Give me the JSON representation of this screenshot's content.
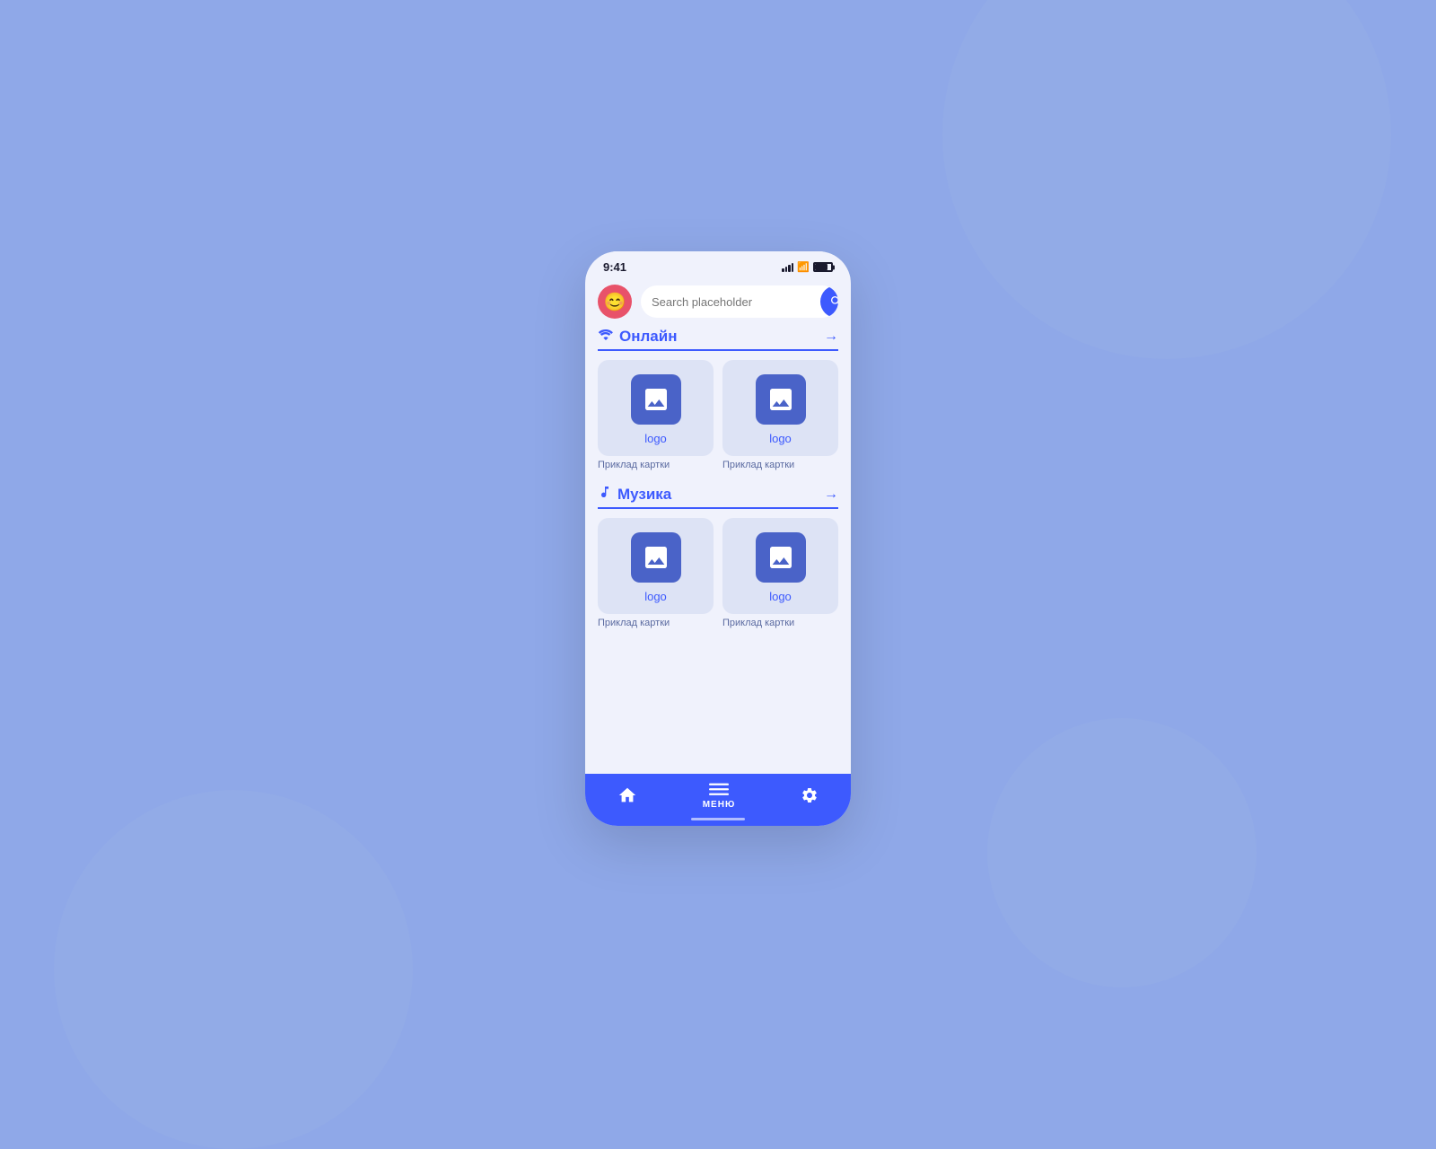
{
  "background": {
    "color": "#8fa8e8"
  },
  "status_bar": {
    "time": "9:41",
    "signal": "signal",
    "wifi": "wifi",
    "battery": "battery"
  },
  "search": {
    "placeholder": "Search placeholder",
    "button_label": "search"
  },
  "avatar": {
    "emoji": "😊"
  },
  "sections": [
    {
      "id": "online",
      "icon": "wifi",
      "title": "Онлайн",
      "arrow": "→",
      "cards": [
        {
          "label": "logo",
          "subtitle": "Приклад картки"
        },
        {
          "label": "logo",
          "subtitle": "Приклад картки"
        }
      ]
    },
    {
      "id": "music",
      "icon": "music",
      "title": "Музика",
      "arrow": "→",
      "cards": [
        {
          "label": "logo",
          "subtitle": "Приклад картки"
        },
        {
          "label": "logo",
          "subtitle": "Приклад картки"
        }
      ]
    }
  ],
  "bottom_nav": {
    "items": [
      {
        "id": "home",
        "label": ""
      },
      {
        "id": "menu",
        "label": "МЕНЮ"
      },
      {
        "id": "settings",
        "label": ""
      }
    ]
  }
}
